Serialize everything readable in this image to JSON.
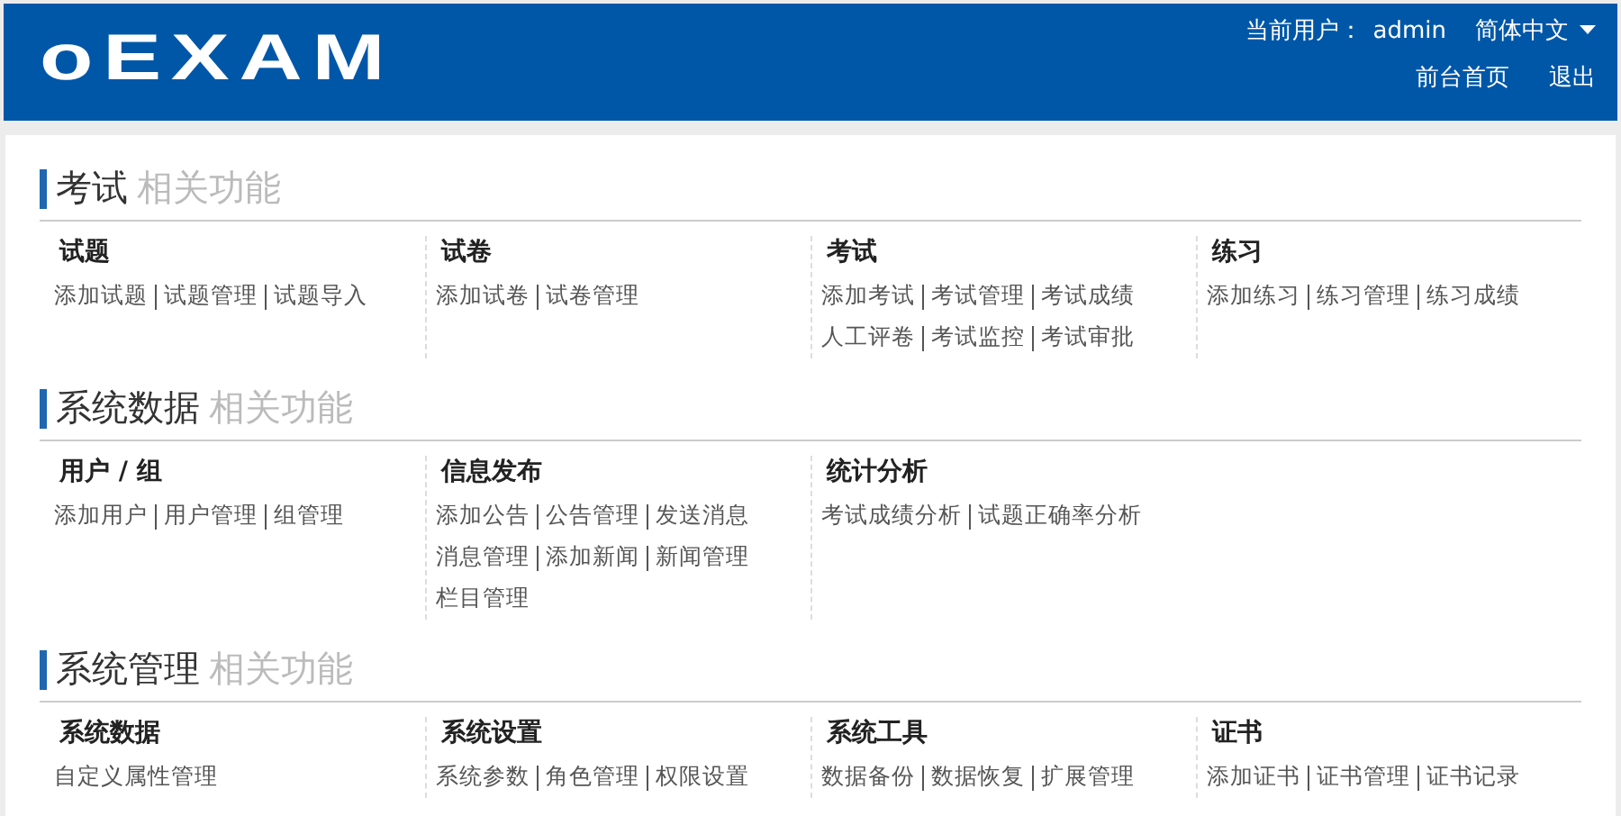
{
  "header": {
    "logo": "oEXAM",
    "user_label": "当前用户：",
    "user_name": "admin",
    "language": "简体中文",
    "links": [
      "前台首页",
      "退出"
    ]
  },
  "sections": [
    {
      "title": "考试",
      "subtitle": "相关功能",
      "groups": [
        {
          "title": "试题",
          "links": [
            "添加试题",
            "试题管理",
            "试题导入"
          ]
        },
        {
          "title": "试卷",
          "links": [
            "添加试卷",
            "试卷管理"
          ]
        },
        {
          "title": "考试",
          "links": [
            "添加考试",
            "考试管理",
            "考试成绩",
            "人工评卷",
            "考试监控",
            "考试审批"
          ]
        },
        {
          "title": "练习",
          "links": [
            "添加练习",
            "练习管理",
            "练习成绩"
          ]
        }
      ]
    },
    {
      "title": "系统数据",
      "subtitle": "相关功能",
      "groups": [
        {
          "title": "用户 / 组",
          "links": [
            "添加用户",
            "用户管理",
            "组管理"
          ]
        },
        {
          "title": "信息发布",
          "links": [
            "添加公告",
            "公告管理",
            "发送消息",
            "消息管理",
            "添加新闻",
            "新闻管理",
            "栏目管理"
          ]
        },
        {
          "title": "统计分析",
          "links": [
            "考试成绩分析",
            "试题正确率分析"
          ]
        }
      ]
    },
    {
      "title": "系统管理",
      "subtitle": "相关功能",
      "groups": [
        {
          "title": "系统数据",
          "links": [
            "自定义属性管理"
          ]
        },
        {
          "title": "系统设置",
          "links": [
            "系统参数",
            "角色管理",
            "权限设置"
          ]
        },
        {
          "title": "系统工具",
          "links": [
            "数据备份",
            "数据恢复",
            "扩展管理"
          ]
        },
        {
          "title": "证书",
          "links": [
            "添加证书",
            "证书管理",
            "证书记录"
          ]
        }
      ]
    }
  ]
}
